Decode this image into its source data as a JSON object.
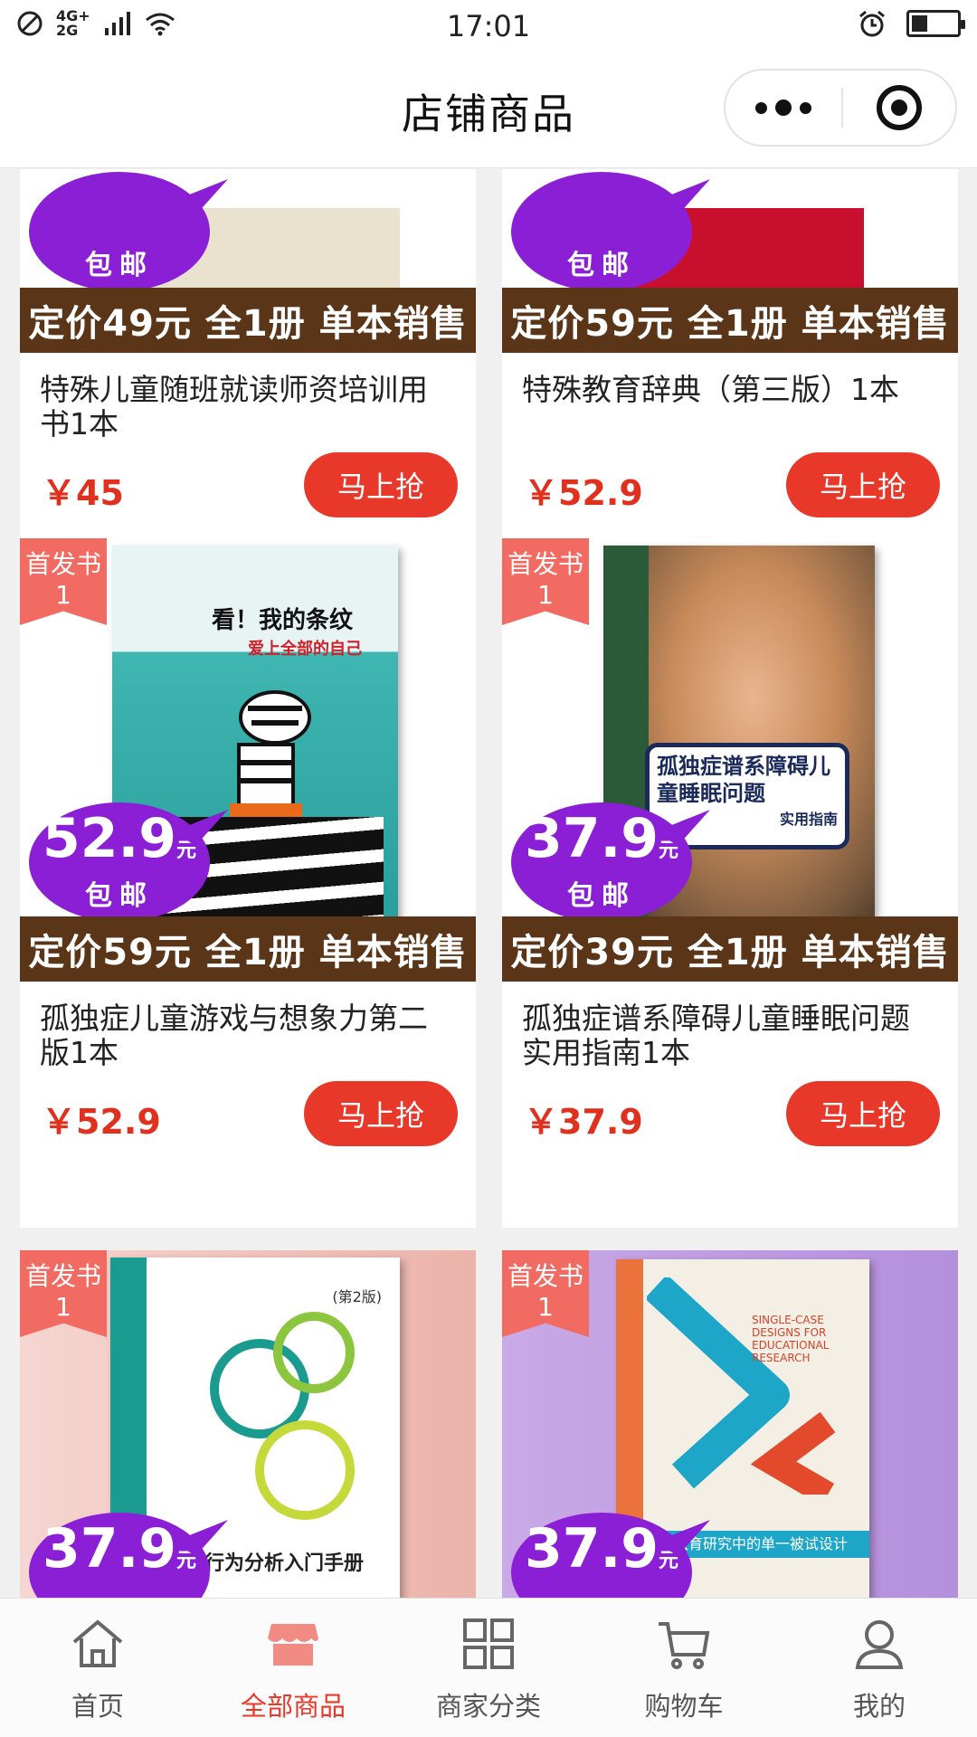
{
  "status_bar": {
    "time": "17:01",
    "network": "4G+ 2G",
    "icons": [
      "no-sim-icon",
      "signal-icon",
      "wifi-icon",
      "alarm-icon",
      "battery-icon"
    ],
    "battery_level": 0.35
  },
  "header": {
    "title": "店铺商品",
    "more_icon": "more-dots-icon",
    "close_icon": "target-icon"
  },
  "products": [
    {
      "title": "特殊儿童随班就读师资培训用书1本",
      "price": "￥45",
      "buy": "马上抢",
      "ribbon": "定价49元 全1册 单本销售",
      "bubble_ship": "包邮",
      "first_badge": ""
    },
    {
      "title": "特殊教育辞典（第三版）1本",
      "price": "￥52.9",
      "buy": "马上抢",
      "ribbon": "定价59元 全1册 单本销售",
      "bubble_ship": "包邮",
      "first_badge": ""
    },
    {
      "title": "孤独症儿童游戏与想象力第二版1本",
      "price": "￥52.9",
      "buy": "马上抢",
      "ribbon": "定价59元 全1册 单本销售",
      "bubble_price": "52.9",
      "bubble_unit": "元",
      "bubble_ship": "包邮",
      "first_badge": "首发书1",
      "book_title": "看！我的条纹",
      "book_subtitle": "爱上全部的自己"
    },
    {
      "title": "孤独症谱系障碍儿童睡眠问题实用指南1本",
      "price": "￥37.9",
      "buy": "马上抢",
      "ribbon": "定价39元 全1册 单本销售",
      "bubble_price": "37.9",
      "bubble_unit": "元",
      "bubble_ship": "包邮",
      "first_badge": "首发书1",
      "book_title": "孤独症谱系障碍儿童睡眠问题",
      "book_subtitle": "实用指南"
    },
    {
      "bubble_price": "37.9",
      "bubble_unit": "元",
      "first_badge": "首发书1",
      "book_title": "应用行为分析入门手册",
      "book_edition": "(第2版)"
    },
    {
      "bubble_price": "37.9",
      "bubble_unit": "元",
      "first_badge": "首发书1",
      "book_title": "SINGLE-CASE DESIGNS FOR EDUCATIONAL RESEARCH",
      "book_subtitle": "教育研究中的单一被试设计"
    }
  ],
  "tabbar": [
    {
      "label": "首页",
      "icon": "home-icon",
      "active": false
    },
    {
      "label": "全部商品",
      "icon": "store-icon",
      "active": true
    },
    {
      "label": "商家分类",
      "icon": "grid-icon",
      "active": false
    },
    {
      "label": "购物车",
      "icon": "cart-icon",
      "active": false
    },
    {
      "label": "我的",
      "icon": "user-icon",
      "active": false
    }
  ],
  "colors": {
    "accent": "#e8382a",
    "price": "#e0301e",
    "bubble": "#8b1fd6",
    "ribbon": "#5a3518",
    "badge": "#f26b63"
  }
}
